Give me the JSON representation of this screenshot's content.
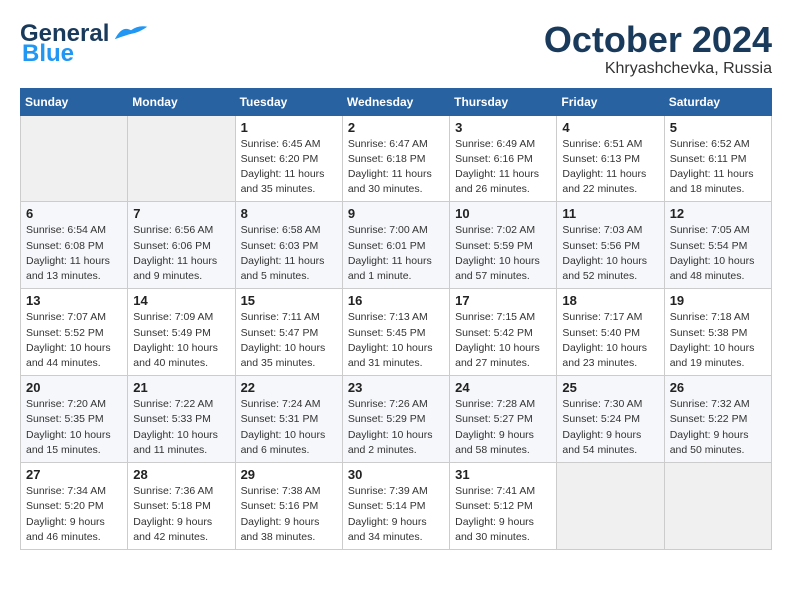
{
  "header": {
    "logo_line1": "General",
    "logo_line2": "Blue",
    "month_title": "October 2024",
    "location": "Khryashchevka, Russia"
  },
  "weekdays": [
    "Sunday",
    "Monday",
    "Tuesday",
    "Wednesday",
    "Thursday",
    "Friday",
    "Saturday"
  ],
  "weeks": [
    [
      {
        "day": "",
        "lines": []
      },
      {
        "day": "",
        "lines": []
      },
      {
        "day": "1",
        "lines": [
          "Sunrise: 6:45 AM",
          "Sunset: 6:20 PM",
          "Daylight: 11 hours",
          "and 35 minutes."
        ]
      },
      {
        "day": "2",
        "lines": [
          "Sunrise: 6:47 AM",
          "Sunset: 6:18 PM",
          "Daylight: 11 hours",
          "and 30 minutes."
        ]
      },
      {
        "day": "3",
        "lines": [
          "Sunrise: 6:49 AM",
          "Sunset: 6:16 PM",
          "Daylight: 11 hours",
          "and 26 minutes."
        ]
      },
      {
        "day": "4",
        "lines": [
          "Sunrise: 6:51 AM",
          "Sunset: 6:13 PM",
          "Daylight: 11 hours",
          "and 22 minutes."
        ]
      },
      {
        "day": "5",
        "lines": [
          "Sunrise: 6:52 AM",
          "Sunset: 6:11 PM",
          "Daylight: 11 hours",
          "and 18 minutes."
        ]
      }
    ],
    [
      {
        "day": "6",
        "lines": [
          "Sunrise: 6:54 AM",
          "Sunset: 6:08 PM",
          "Daylight: 11 hours",
          "and 13 minutes."
        ]
      },
      {
        "day": "7",
        "lines": [
          "Sunrise: 6:56 AM",
          "Sunset: 6:06 PM",
          "Daylight: 11 hours",
          "and 9 minutes."
        ]
      },
      {
        "day": "8",
        "lines": [
          "Sunrise: 6:58 AM",
          "Sunset: 6:03 PM",
          "Daylight: 11 hours",
          "and 5 minutes."
        ]
      },
      {
        "day": "9",
        "lines": [
          "Sunrise: 7:00 AM",
          "Sunset: 6:01 PM",
          "Daylight: 11 hours",
          "and 1 minute."
        ]
      },
      {
        "day": "10",
        "lines": [
          "Sunrise: 7:02 AM",
          "Sunset: 5:59 PM",
          "Daylight: 10 hours",
          "and 57 minutes."
        ]
      },
      {
        "day": "11",
        "lines": [
          "Sunrise: 7:03 AM",
          "Sunset: 5:56 PM",
          "Daylight: 10 hours",
          "and 52 minutes."
        ]
      },
      {
        "day": "12",
        "lines": [
          "Sunrise: 7:05 AM",
          "Sunset: 5:54 PM",
          "Daylight: 10 hours",
          "and 48 minutes."
        ]
      }
    ],
    [
      {
        "day": "13",
        "lines": [
          "Sunrise: 7:07 AM",
          "Sunset: 5:52 PM",
          "Daylight: 10 hours",
          "and 44 minutes."
        ]
      },
      {
        "day": "14",
        "lines": [
          "Sunrise: 7:09 AM",
          "Sunset: 5:49 PM",
          "Daylight: 10 hours",
          "and 40 minutes."
        ]
      },
      {
        "day": "15",
        "lines": [
          "Sunrise: 7:11 AM",
          "Sunset: 5:47 PM",
          "Daylight: 10 hours",
          "and 35 minutes."
        ]
      },
      {
        "day": "16",
        "lines": [
          "Sunrise: 7:13 AM",
          "Sunset: 5:45 PM",
          "Daylight: 10 hours",
          "and 31 minutes."
        ]
      },
      {
        "day": "17",
        "lines": [
          "Sunrise: 7:15 AM",
          "Sunset: 5:42 PM",
          "Daylight: 10 hours",
          "and 27 minutes."
        ]
      },
      {
        "day": "18",
        "lines": [
          "Sunrise: 7:17 AM",
          "Sunset: 5:40 PM",
          "Daylight: 10 hours",
          "and 23 minutes."
        ]
      },
      {
        "day": "19",
        "lines": [
          "Sunrise: 7:18 AM",
          "Sunset: 5:38 PM",
          "Daylight: 10 hours",
          "and 19 minutes."
        ]
      }
    ],
    [
      {
        "day": "20",
        "lines": [
          "Sunrise: 7:20 AM",
          "Sunset: 5:35 PM",
          "Daylight: 10 hours",
          "and 15 minutes."
        ]
      },
      {
        "day": "21",
        "lines": [
          "Sunrise: 7:22 AM",
          "Sunset: 5:33 PM",
          "Daylight: 10 hours",
          "and 11 minutes."
        ]
      },
      {
        "day": "22",
        "lines": [
          "Sunrise: 7:24 AM",
          "Sunset: 5:31 PM",
          "Daylight: 10 hours",
          "and 6 minutes."
        ]
      },
      {
        "day": "23",
        "lines": [
          "Sunrise: 7:26 AM",
          "Sunset: 5:29 PM",
          "Daylight: 10 hours",
          "and 2 minutes."
        ]
      },
      {
        "day": "24",
        "lines": [
          "Sunrise: 7:28 AM",
          "Sunset: 5:27 PM",
          "Daylight: 9 hours",
          "and 58 minutes."
        ]
      },
      {
        "day": "25",
        "lines": [
          "Sunrise: 7:30 AM",
          "Sunset: 5:24 PM",
          "Daylight: 9 hours",
          "and 54 minutes."
        ]
      },
      {
        "day": "26",
        "lines": [
          "Sunrise: 7:32 AM",
          "Sunset: 5:22 PM",
          "Daylight: 9 hours",
          "and 50 minutes."
        ]
      }
    ],
    [
      {
        "day": "27",
        "lines": [
          "Sunrise: 7:34 AM",
          "Sunset: 5:20 PM",
          "Daylight: 9 hours",
          "and 46 minutes."
        ]
      },
      {
        "day": "28",
        "lines": [
          "Sunrise: 7:36 AM",
          "Sunset: 5:18 PM",
          "Daylight: 9 hours",
          "and 42 minutes."
        ]
      },
      {
        "day": "29",
        "lines": [
          "Sunrise: 7:38 AM",
          "Sunset: 5:16 PM",
          "Daylight: 9 hours",
          "and 38 minutes."
        ]
      },
      {
        "day": "30",
        "lines": [
          "Sunrise: 7:39 AM",
          "Sunset: 5:14 PM",
          "Daylight: 9 hours",
          "and 34 minutes."
        ]
      },
      {
        "day": "31",
        "lines": [
          "Sunrise: 7:41 AM",
          "Sunset: 5:12 PM",
          "Daylight: 9 hours",
          "and 30 minutes."
        ]
      },
      {
        "day": "",
        "lines": []
      },
      {
        "day": "",
        "lines": []
      }
    ]
  ]
}
